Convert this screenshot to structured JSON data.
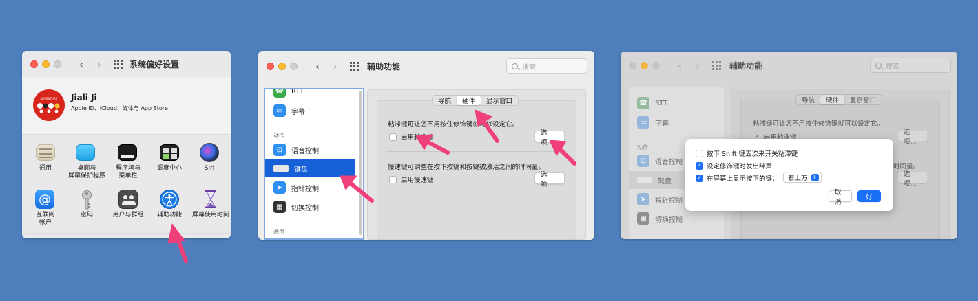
{
  "panel1": {
    "title": "系统偏好设置",
    "user_name": "Jiali Ji",
    "user_sub": "Apple ID、iCloud、媒体与 App Store",
    "icons_row1": [
      {
        "label": "通用",
        "icon": "general-icon"
      },
      {
        "label": "桌面与\n屏幕保护程序",
        "icon": "desktop-icon"
      },
      {
        "label": "程序坞与\n菜单栏",
        "icon": "dock-icon"
      },
      {
        "label": "调度中心",
        "icon": "mission-control-icon"
      },
      {
        "label": "Siri",
        "icon": "siri-icon"
      }
    ],
    "icons_row2": [
      {
        "label": "互联网\n帐户",
        "icon": "internet-accounts-icon"
      },
      {
        "label": "密码",
        "icon": "key-icon"
      },
      {
        "label": "用户与群组",
        "icon": "users-icon"
      },
      {
        "label": "辅助功能",
        "icon": "accessibility-icon"
      },
      {
        "label": "屏幕使用时间",
        "icon": "hourglass-icon"
      }
    ]
  },
  "panel2": {
    "title": "辅助功能",
    "search_placeholder": "搜索",
    "sidebar": {
      "rtt": "RTT",
      "captions": "字幕",
      "section_motor": "动作",
      "voice_control": "语音控制",
      "keyboard": "键盘",
      "pointer_control": "指针控制",
      "switch_control": "切换控制",
      "section_general": "通用"
    },
    "tabs": [
      "导航",
      "硬件",
      "显示窗口"
    ],
    "sticky_desc": "粘滞键可让您不用按住修饰键就可以设定它。",
    "sticky_label": "启用粘滞键",
    "options": "选项...",
    "slow_desc": "慢速键可调整在按下按键和按键被激活之间的时间量。",
    "slow_label": "启用慢速键"
  },
  "panel3": {
    "title": "辅助功能",
    "search_placeholder": "搜索",
    "sidebar": {
      "rtt": "RTT",
      "captions": "字幕",
      "section_motor": "动作",
      "voice_control": "语音控制",
      "keyboard": "键盘",
      "pointer_control": "指针控制",
      "switch_control": "切换控制"
    },
    "tabs": [
      "导航",
      "硬件",
      "显示窗口"
    ],
    "sticky_desc": "粘滞键可让您不用按住修饰键就可以设定它。",
    "sticky_label": "启用粘滞键",
    "options": "选项...",
    "slow_desc": "时间量。",
    "dialog": {
      "opt1": "按下 Shift 键五次来开关粘滞键",
      "opt2": "设定修饰键时发出哔声",
      "opt3": "在屏幕上显示按下的键：",
      "position": "右上方",
      "cancel": "取消",
      "ok": "好"
    }
  },
  "colors": {
    "background": "#4e7fbc",
    "accent": "#1b6ff5",
    "annotation_arrow": "#f0407a"
  }
}
